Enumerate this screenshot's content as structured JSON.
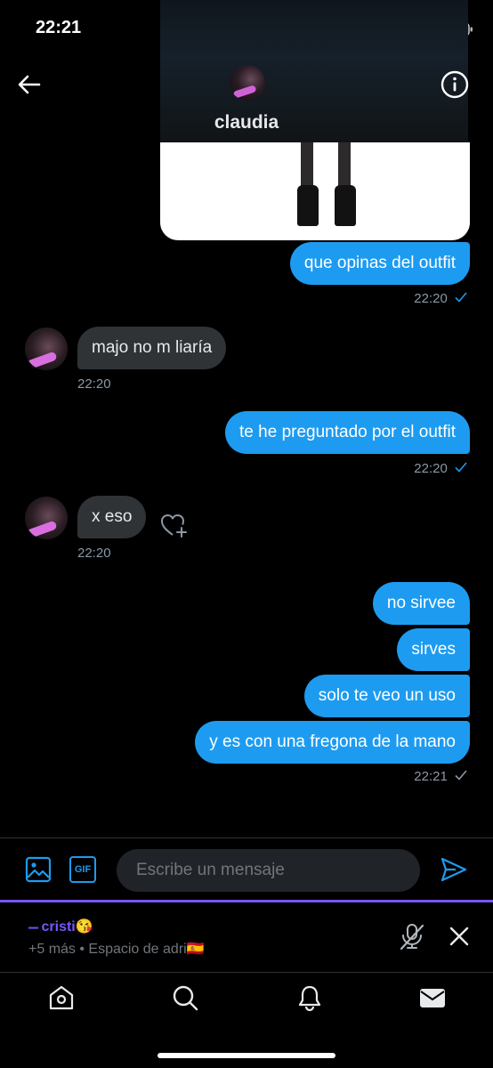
{
  "status_bar": {
    "time": "22:21"
  },
  "header": {
    "contact_name": "claudia"
  },
  "conversation": {
    "messages": [
      {
        "dir": "sent",
        "text": "que opinas del outfit",
        "time": "22:20"
      },
      {
        "dir": "recv",
        "text": "majo no m liaría",
        "time": "22:20"
      },
      {
        "dir": "sent",
        "text": "te he preguntado por el outfit",
        "time": "22:20"
      },
      {
        "dir": "recv",
        "text": "x eso",
        "time": "22:20"
      },
      {
        "dir": "sent",
        "text": "no sirvee"
      },
      {
        "dir": "sent",
        "text": "sirves"
      },
      {
        "dir": "sent",
        "text": "solo te veo un uso"
      },
      {
        "dir": "sent",
        "text": "y es con una fregona de la mano",
        "time": "22:21"
      }
    ]
  },
  "composer": {
    "placeholder": "Escribe un mensaje",
    "gif_label": "GIF"
  },
  "spaces_bar": {
    "host": "cristi",
    "host_emoji": "😘",
    "subtitle": "+5 más • Espacio de adri",
    "subtitle_emoji": "🇪🇸"
  },
  "colors": {
    "accent": "#1d9bf0",
    "spaces_accent": "#7856ff",
    "received_bubble": "#2f3336"
  },
  "icons": [
    "back-arrow-icon",
    "info-icon",
    "image-icon",
    "gif-icon",
    "send-icon",
    "mic-off-icon",
    "close-icon",
    "home-icon",
    "search-icon",
    "bell-icon",
    "mail-icon",
    "heart-add-icon",
    "check-icon"
  ]
}
